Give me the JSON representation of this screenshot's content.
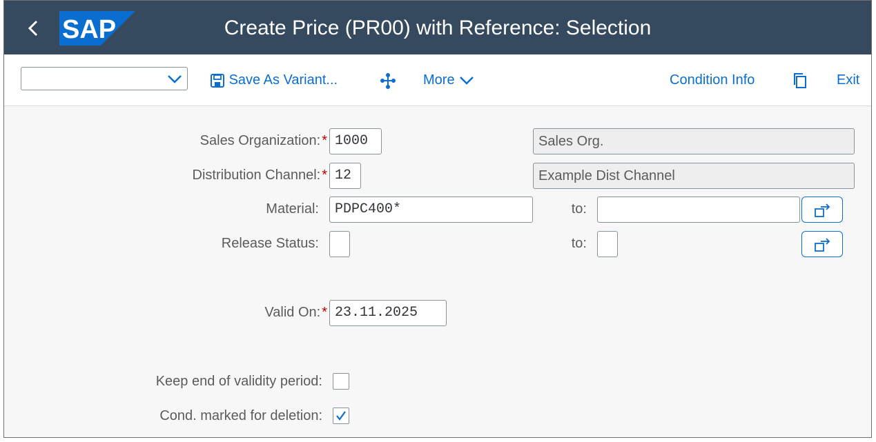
{
  "shell": {
    "title": "Create Price (PR00) with Reference: Selection",
    "logo_text": "SAP",
    "colors": {
      "shellbar": "#354a5f",
      "logo_blue": "#0a6ed1",
      "link": "#0a6ed1",
      "required": "#bb0000"
    }
  },
  "toolbar": {
    "variant_value": "",
    "save_variant_label": "Save As Variant...",
    "more_label": "More",
    "condition_info_label": "Condition Info",
    "exit_label": "Exit",
    "icons": [
      "save-icon",
      "network-icon",
      "chevron-down-icon",
      "copy-icon"
    ]
  },
  "form": {
    "sales_org": {
      "label": "Sales Organization:",
      "required": "*",
      "value": "1000",
      "description": "Sales Org."
    },
    "dist_channel": {
      "label": "Distribution Channel:",
      "required": "*",
      "value": "12",
      "description": "Example Dist Channel"
    },
    "material": {
      "label": "Material:",
      "value": "PDPC400*",
      "to_label": "to:",
      "to_value": ""
    },
    "release_status": {
      "label": "Release Status:",
      "value": "",
      "to_label": "to:",
      "to_value": ""
    },
    "valid_on": {
      "label": "Valid On:",
      "required": "*",
      "value": "23.11.2025"
    },
    "keep_end": {
      "label": "Keep end of validity period:",
      "checked": false
    },
    "cond_deletion": {
      "label": "Cond. marked for deletion:",
      "checked": true
    }
  }
}
